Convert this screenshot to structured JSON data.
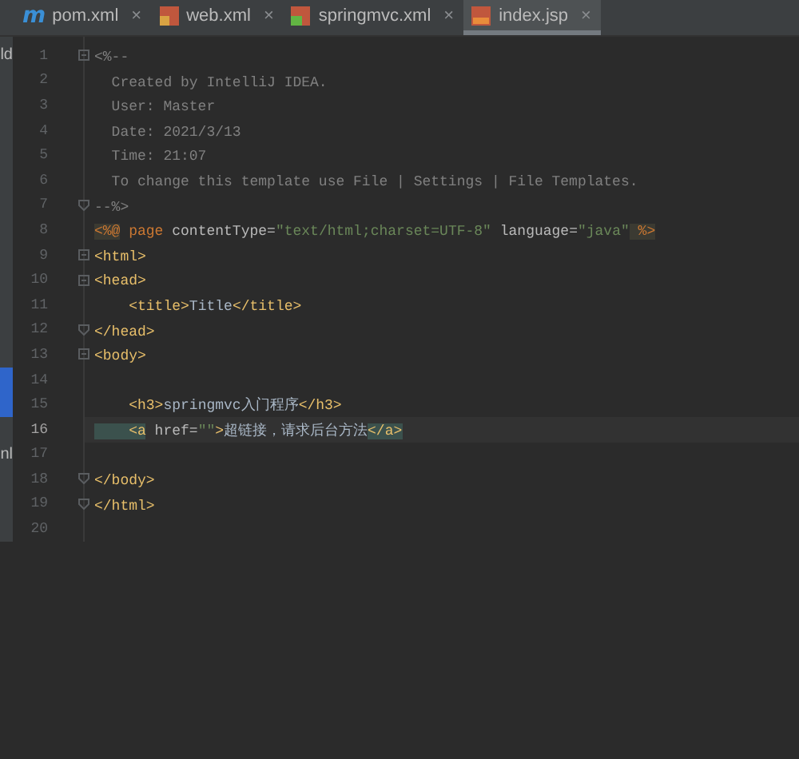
{
  "tabs": [
    {
      "label": "pom.xml",
      "kind": "maven",
      "icon_text": "m",
      "close": "×",
      "selected": false
    },
    {
      "label": "web.xml",
      "kind": "xml",
      "close": "×",
      "selected": false
    },
    {
      "label": "springmvc.xml",
      "kind": "spring",
      "close": "×",
      "selected": false
    },
    {
      "label": "index.jsp",
      "kind": "jsp",
      "close": "×",
      "selected": true
    }
  ],
  "lines": [
    {
      "number": "1",
      "side": "ld",
      "kind": "fold_start",
      "current": false,
      "tokens": [
        {
          "kind": "comment",
          "text": "<%--"
        }
      ]
    },
    {
      "number": "2",
      "kind": "plain",
      "current": false,
      "tokens": [
        {
          "kind": "comment",
          "text": "  Created by IntelliJ IDEA."
        }
      ]
    },
    {
      "number": "3",
      "kind": "plain",
      "current": false,
      "tokens": [
        {
          "kind": "comment",
          "text": "  User: Master"
        }
      ]
    },
    {
      "number": "4",
      "kind": "plain",
      "current": false,
      "tokens": [
        {
          "kind": "comment",
          "text": "  Date: 2021/3/13"
        }
      ]
    },
    {
      "number": "5",
      "kind": "plain",
      "current": false,
      "tokens": [
        {
          "kind": "comment",
          "text": "  Time: 21:07"
        }
      ]
    },
    {
      "number": "6",
      "kind": "plain",
      "current": false,
      "tokens": [
        {
          "kind": "comment",
          "text": "  To change this template use File | Settings | File Templates."
        }
      ]
    },
    {
      "number": "7",
      "kind": "fold_end",
      "current": false,
      "tokens": [
        {
          "kind": "comment",
          "text": "--%>"
        }
      ]
    },
    {
      "number": "8",
      "kind": "plain",
      "current": false,
      "tokens": [
        {
          "kind": "directive",
          "text": "<%@"
        },
        {
          "kind": "keyword",
          "text": " page"
        },
        {
          "kind": "attr",
          "text": " contentType="
        },
        {
          "kind": "string",
          "text": "\"text/html;charset=UTF-8\""
        },
        {
          "kind": "attr",
          "text": " language="
        },
        {
          "kind": "string",
          "text": "\"java\""
        },
        {
          "kind": "directive",
          "text": " %>"
        }
      ]
    },
    {
      "number": "9",
      "kind": "fold_start",
      "current": false,
      "tokens": [
        {
          "kind": "tag",
          "text": "<html>"
        }
      ]
    },
    {
      "number": "10",
      "kind": "fold_start",
      "current": false,
      "tokens": [
        {
          "kind": "tag",
          "text": "<head>"
        }
      ]
    },
    {
      "number": "11",
      "kind": "plain",
      "current": false,
      "tokens": [
        {
          "kind": "tag",
          "text": "    <title>"
        },
        {
          "kind": "text",
          "text": "Title"
        },
        {
          "kind": "tag",
          "text": "</title>"
        }
      ]
    },
    {
      "number": "12",
      "kind": "fold_end",
      "current": false,
      "tokens": [
        {
          "kind": "tag",
          "text": "</head>"
        }
      ]
    },
    {
      "number": "13",
      "kind": "fold_start",
      "current": false,
      "tokens": [
        {
          "kind": "tag",
          "text": "<body>"
        }
      ]
    },
    {
      "number": "14",
      "kind": "plain",
      "current": false
    },
    {
      "number": "15",
      "kind": "plain",
      "current": false,
      "tokens": [
        {
          "kind": "tag",
          "text": "    <h3>"
        },
        {
          "kind": "text",
          "text": "springmvc入门程序"
        },
        {
          "kind": "tag",
          "text": "</h3>"
        }
      ]
    },
    {
      "number": "16",
      "kind": "plain",
      "current": true,
      "tokens": [
        {
          "kind": "tag_match",
          "text": "    <a"
        },
        {
          "kind": "attr",
          "text": " href="
        },
        {
          "kind": "string",
          "text": "\"\""
        },
        {
          "kind": "tag",
          "text": ">"
        },
        {
          "kind": "text",
          "text": "超链接，请求后台方法"
        },
        {
          "kind": "tag_match",
          "text": "</a>"
        }
      ]
    },
    {
      "number": "17",
      "side": "nl",
      "kind": "plain",
      "current": false
    },
    {
      "number": "18",
      "kind": "fold_end",
      "current": false,
      "tokens": [
        {
          "kind": "tag",
          "text": "</body>"
        }
      ]
    },
    {
      "number": "19",
      "kind": "fold_end",
      "current": false,
      "tokens": [
        {
          "kind": "tag",
          "text": "</html>"
        }
      ]
    },
    {
      "number": "20",
      "kind": "plain",
      "current": false
    }
  ]
}
